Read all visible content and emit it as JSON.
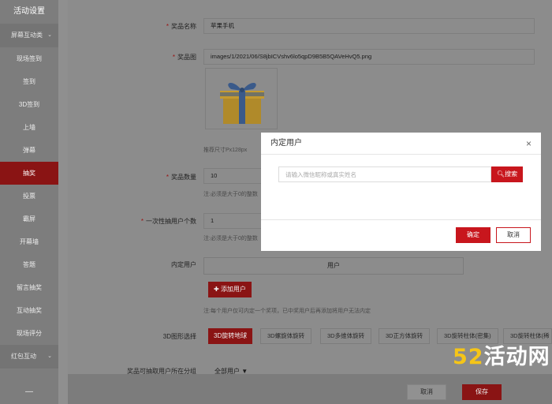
{
  "sidebar": {
    "title": "活动设置",
    "group": "屏幕互动类",
    "items": [
      "现场签到",
      "签到",
      "3D签到",
      "上墙",
      "弹幕",
      "抽奖",
      "投票",
      "霸屏",
      "开幕墙",
      "答题",
      "留言抽奖",
      "互动抽奖",
      "现场评分"
    ],
    "active_index": 5,
    "group2": "红包互动",
    "bottom": "—"
  },
  "form": {
    "prize_name_label": "奖品名称",
    "prize_name_value": "苹果手机",
    "prize_image_label": "奖品图",
    "prize_image_path": "images/1/2021/06/S8jbICVshv6lo5qpD9B5B5QAVeHvQ5.png",
    "image_size_hint": "推荐尺寸Px128px",
    "prize_count_label": "奖品数量",
    "prize_count_value": "10",
    "prize_count_hint": "注:必须是大于0的整数",
    "per_round_label": "一次性抽用户个数",
    "per_round_value": "1",
    "per_round_hint": "注:必须是大于0的整数",
    "inner_user_label": "内定用户",
    "table_header": "用户",
    "add_user_btn": "添加用户",
    "inner_user_hint": "注:每个用户仅可内定一个奖项，已中奖用户后再添加将用户无法内定",
    "graphic_label": "3D图形选择",
    "graphic_options": [
      "3D旋转地球",
      "3D螺旋体旋转",
      "3D多维体旋转",
      "3D正方体旋转",
      "3D旋转柱体(密集)",
      "3D旋转柱体(稀"
    ],
    "graphic_selected": 0,
    "group_label": "奖品可抽取用户所在分组",
    "group_value": "全部用户"
  },
  "footer": {
    "cancel": "取消",
    "save": "保存"
  },
  "modal": {
    "title": "内定用户",
    "close": "×",
    "search_placeholder": "请输入微信昵称或真实姓名",
    "search_button": "搜索",
    "ok": "确定",
    "cancel": "取消"
  },
  "watermark": {
    "num": "52",
    "text": "活动网"
  },
  "colors": {
    "accent": "#c8161d",
    "accent_dim": "#8a1414",
    "overlay": "#8c8c8c"
  }
}
